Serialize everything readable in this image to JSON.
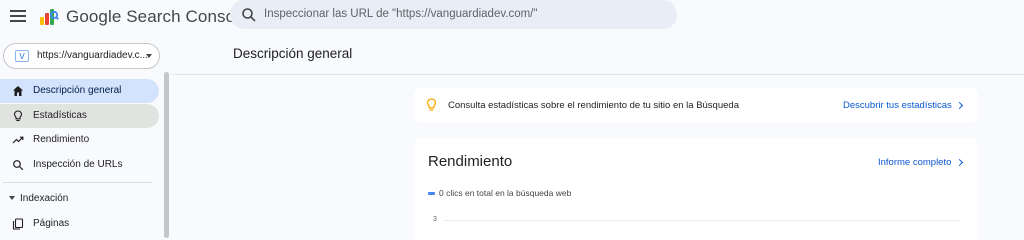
{
  "header": {
    "app_title": "Google Search Console",
    "search_placeholder": "Inspeccionar las URL de \"https://vanguardiadev.com/\""
  },
  "property_selector": {
    "label": "https://vanguardiadev.c..."
  },
  "sidebar": {
    "items": [
      {
        "label": "Descripción general",
        "icon": "home-icon",
        "state": "active"
      },
      {
        "label": "Estadísticas",
        "icon": "lightbulb-icon",
        "state": "hover"
      },
      {
        "label": "Rendimiento",
        "icon": "trending-up-icon",
        "state": "normal"
      },
      {
        "label": "Inspección de URLs",
        "icon": "search-icon",
        "state": "normal"
      }
    ],
    "section": {
      "label": "Indexación",
      "icon": "caret-down-icon"
    },
    "section_items": [
      {
        "label": "Páginas",
        "icon": "pages-icon"
      }
    ]
  },
  "main": {
    "page_title": "Descripción general",
    "insight_card": {
      "text": "Consulta estadísticas sobre el rendimiento de tu sitio en la Búsqueda",
      "link": "Descubrir tus estadísticas",
      "icon": "lightbulb-icon"
    },
    "performance_card": {
      "title": "Rendimiento",
      "link": "Informe completo",
      "legend": "0 clics en total en la búsqueda web",
      "legend_color": "#4285f4",
      "y_tick": "3"
    }
  },
  "colors": {
    "accent": "#0b57d0",
    "active_nav": "#d3e3fd",
    "background": "#f8fafd"
  }
}
